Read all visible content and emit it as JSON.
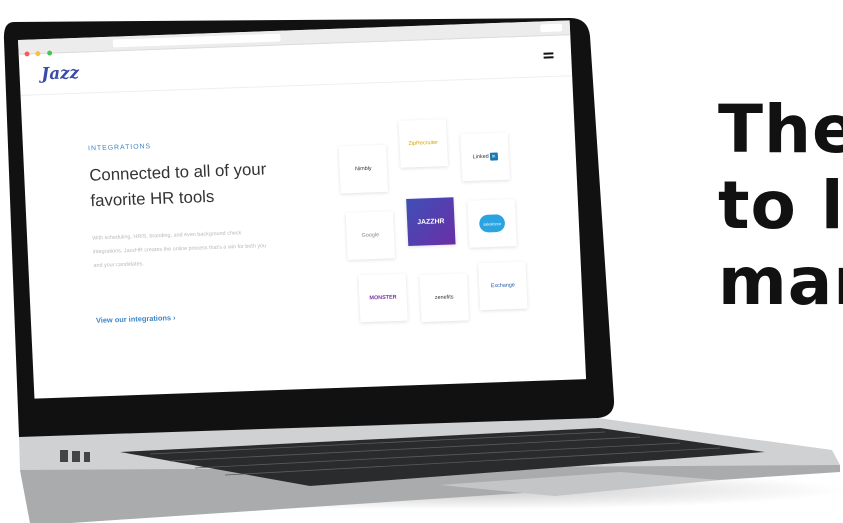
{
  "headline": {
    "lines": [
      "The",
      "to l",
      "mar"
    ]
  },
  "website": {
    "logo": "Jazz",
    "eyebrow": "INTEGRATIONS",
    "heading": "Connected to all of your favorite HR tools",
    "body": "With scheduling, HRIS, branding, and even background check integrations, JazzHR creates the online process that's a win for both you and your candidates.",
    "cta": "View our integrations ›",
    "tiles": {
      "nimbly": "Nimbly",
      "zipr": "ZipRecruiter",
      "linkedin": "Linked",
      "linkedin_badge": "in",
      "google": "Google",
      "jazzhr": "JAZZHR",
      "salesforce": "salesforce",
      "monster": "MONSTER",
      "zenefits": "zenefits",
      "exchange": "Exchange"
    }
  },
  "colors": {
    "brand": "#3a4aa8",
    "accent": "#3b86c6",
    "headline": "#111111"
  }
}
